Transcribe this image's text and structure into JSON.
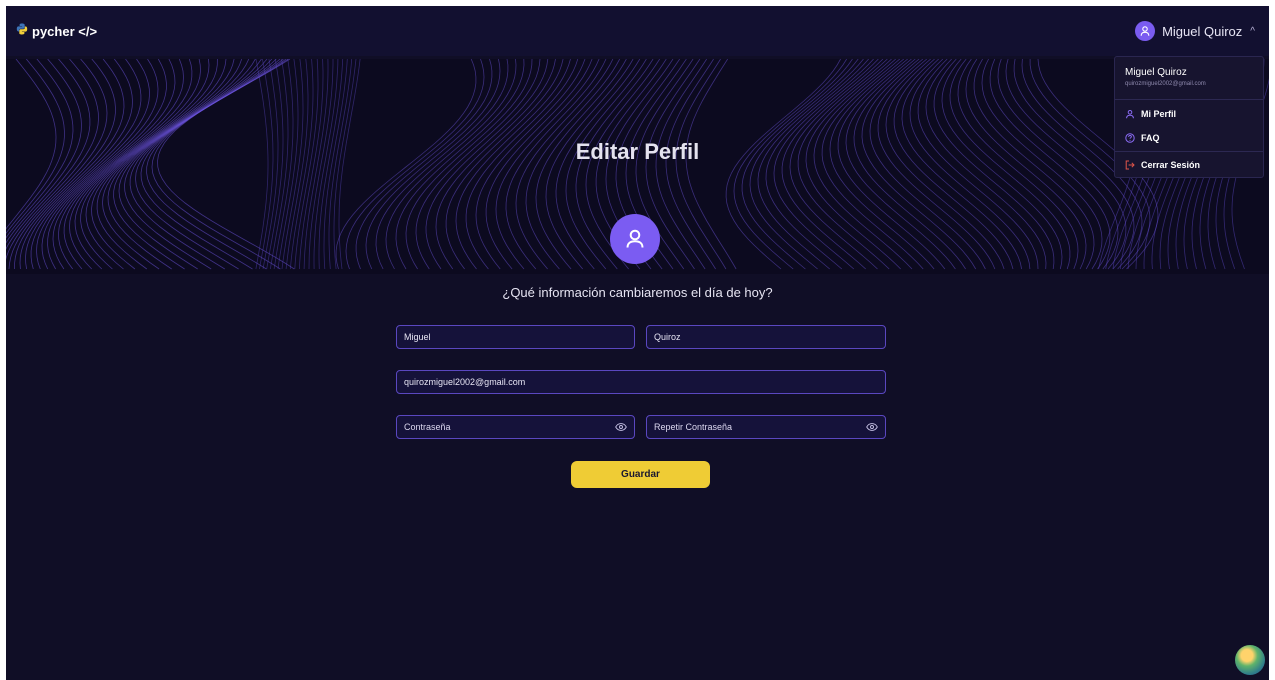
{
  "navbar": {
    "brand": "pycher </>",
    "brand_icon": "python-icon",
    "user_name": "Miguel Quiroz",
    "user_icon": "user-icon",
    "caret_icon": "chevron-up-icon"
  },
  "hero": {
    "title": "Editar Perfil"
  },
  "form": {
    "question": "¿Qué información cambiaremos el día de hoy?",
    "first_name": "Miguel",
    "last_name": "Quiroz",
    "email": "quirozmiguel2002@gmail.com",
    "password_placeholder": "Contraseña",
    "repeat_password_placeholder": "Repetir Contraseña",
    "save_label": "Guardar"
  },
  "dropdown": {
    "name": "Miguel Quiroz",
    "email": "quirozmiguel2002@gmail.com",
    "items": [
      {
        "label": "Mi Perfil",
        "icon": "user-icon"
      },
      {
        "label": "FAQ",
        "icon": "help-circle-icon"
      },
      {
        "label": "Cerrar Sesión",
        "icon": "logout-icon"
      }
    ]
  },
  "colors": {
    "background": "#100e26",
    "accent": "#7b5cf2",
    "button": "#efcc35",
    "logout": "#e0554a"
  }
}
